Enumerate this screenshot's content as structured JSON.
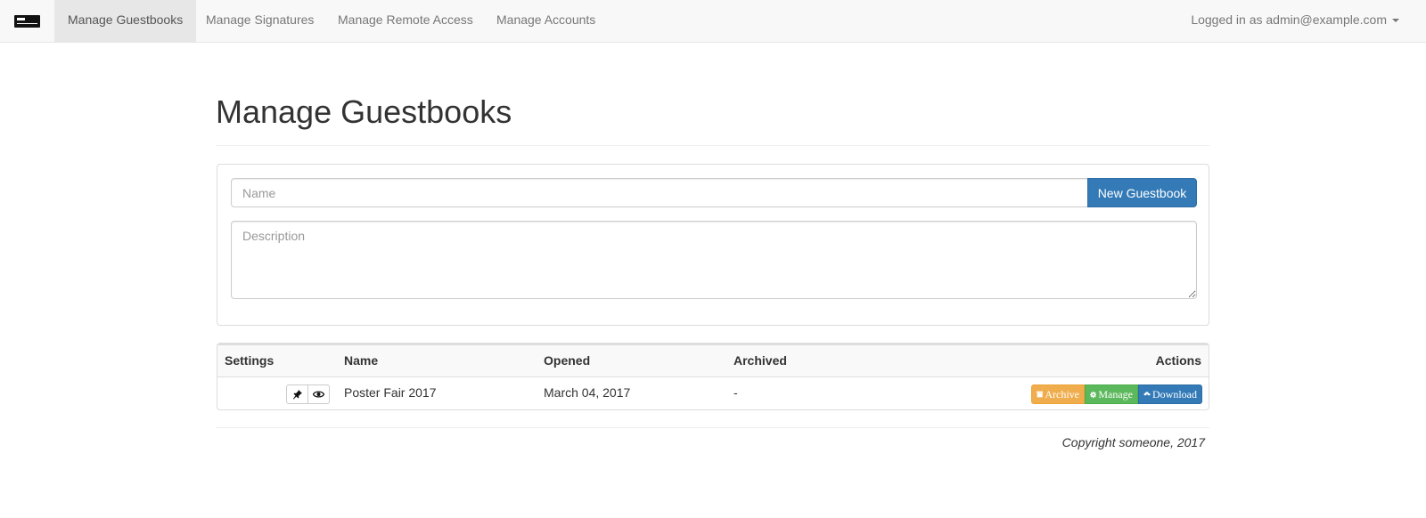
{
  "navbar": {
    "brand_icon": "brand-logo-icon",
    "items": [
      {
        "label": "Manage Guestbooks",
        "active": true
      },
      {
        "label": "Manage Signatures",
        "active": false
      },
      {
        "label": "Manage Remote Access",
        "active": false
      },
      {
        "label": "Manage Accounts",
        "active": false
      }
    ],
    "user_label": "Logged in as admin@example.com"
  },
  "page": {
    "title": "Manage Guestbooks"
  },
  "form": {
    "name_placeholder": "Name",
    "name_value": "",
    "new_button_label": "New Guestbook",
    "description_placeholder": "Description",
    "description_value": ""
  },
  "table": {
    "headers": {
      "settings": "Settings",
      "name": "Name",
      "opened": "Opened",
      "archived": "Archived",
      "actions": "Actions"
    },
    "rows": [
      {
        "settings_icons": [
          "pin-icon",
          "eye-icon"
        ],
        "name": "Poster Fair 2017",
        "opened": "March 04, 2017",
        "archived": "-",
        "actions": {
          "archive": "Archive",
          "manage": "Manage",
          "download": "Download"
        }
      }
    ]
  },
  "footer": {
    "copyright": "Copyright someone, 2017"
  },
  "colors": {
    "primary": "#337ab7",
    "warning": "#f0ad4e",
    "success": "#5cb85c",
    "navbar_bg": "#f8f8f8"
  }
}
